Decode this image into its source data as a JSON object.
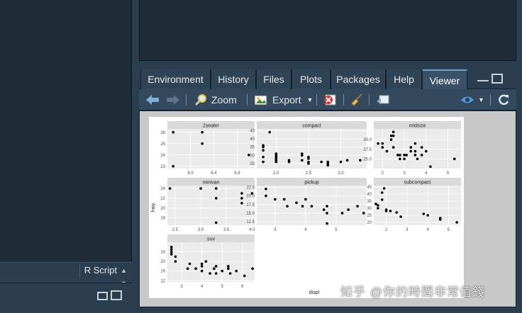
{
  "left_pane": {
    "script_type": "R Script"
  },
  "tabs": [
    {
      "label": "Environment",
      "active": false
    },
    {
      "label": "History",
      "active": false
    },
    {
      "label": "Files",
      "active": false
    },
    {
      "label": "Plots",
      "active": false
    },
    {
      "label": "Packages",
      "active": false
    },
    {
      "label": "Help",
      "active": false
    },
    {
      "label": "Viewer",
      "active": true
    }
  ],
  "toolbar": {
    "zoom_label": "Zoom",
    "export_label": "Export"
  },
  "icons": {
    "back": "arrow-left-icon",
    "forward": "arrow-right-icon",
    "zoom": "magnifier-icon",
    "export": "image-export-icon",
    "remove": "remove-icon",
    "clear": "broom-icon",
    "popout": "popout-icon",
    "publish": "publish-icon",
    "refresh": "refresh-icon"
  },
  "watermark": "知乎 @你的時間非常值錢",
  "chart_data": {
    "type": "scatter",
    "xlabel": "displ",
    "ylabel": "hwy",
    "facets": [
      {
        "name": "2seater",
        "xlim": [
          5.6,
          7.1
        ],
        "ylim": [
          22.8,
          26.3
        ],
        "xticks": [
          6.0,
          6.4,
          6.8
        ],
        "yticks": [
          23,
          24,
          25,
          26
        ],
        "x": [
          5.7,
          5.7,
          6.2,
          6.2,
          7.0
        ],
        "y": [
          26,
          23,
          26,
          25,
          24
        ]
      },
      {
        "name": "compact",
        "xlim": [
          1.7,
          3.4
        ],
        "ylim": [
          22,
          46
        ],
        "xticks": [
          2.0,
          2.5,
          3.0
        ],
        "yticks": [
          25,
          30,
          35,
          40,
          45
        ],
        "x": [
          1.8,
          1.8,
          1.8,
          1.8,
          1.8,
          1.9,
          2.0,
          2.0,
          2.0,
          2.0,
          2.0,
          2.0,
          2.2,
          2.2,
          2.4,
          2.4,
          2.4,
          2.5,
          2.5,
          2.5,
          2.5,
          2.7,
          2.8,
          2.8,
          2.8,
          3.0,
          3.1,
          3.3
        ],
        "y": [
          29,
          33,
          35,
          36,
          26,
          44,
          28,
          29,
          31,
          30,
          27,
          26,
          27,
          26,
          30,
          31,
          27,
          29,
          28,
          26,
          25,
          26,
          24,
          25,
          26,
          26,
          27,
          27
        ]
      },
      {
        "name": "midsize",
        "xlim": [
          1.6,
          5.6
        ],
        "ylim": [
          22.5,
          32.8
        ],
        "xticks": [
          2,
          3,
          4,
          5
        ],
        "yticks": [
          25.0,
          27.5,
          30.0
        ],
        "x": [
          1.8,
          2.0,
          2.0,
          2.2,
          2.4,
          2.4,
          2.5,
          2.5,
          2.5,
          2.7,
          2.8,
          2.8,
          3.0,
          3.0,
          3.1,
          3.3,
          3.3,
          3.5,
          3.5,
          3.5,
          3.6,
          3.8,
          3.8,
          4.0,
          4.2,
          5.3
        ],
        "y": [
          29,
          28,
          29,
          27,
          31,
          30,
          32,
          31,
          28,
          26,
          26,
          25,
          26,
          25,
          26,
          28,
          27,
          26,
          29,
          27,
          25,
          26,
          28,
          27,
          23,
          25
        ]
      },
      {
        "name": "minivan",
        "xlim": [
          2.35,
          4.05
        ],
        "ylim": [
          16.5,
          24.6
        ],
        "xticks": [
          2.5,
          3.0,
          3.5,
          4.0
        ],
        "yticks": [
          18,
          20,
          22,
          24
        ],
        "x": [
          2.4,
          3.0,
          3.3,
          3.3,
          3.3,
          3.8,
          3.8,
          3.8,
          4.0
        ],
        "y": [
          24,
          24,
          24,
          22,
          17,
          23,
          22,
          21,
          23
        ]
      },
      {
        "name": "pickup",
        "xlim": [
          2.4,
          6.0
        ],
        "ylim": [
          11.5,
          23.0
        ],
        "xticks": [
          3,
          4,
          5
        ],
        "yticks": [
          12.5,
          15.0,
          17.5,
          20.0,
          22.5
        ],
        "x": [
          2.7,
          2.7,
          3.0,
          3.3,
          3.4,
          3.7,
          3.9,
          4.0,
          4.2,
          4.6,
          4.7,
          4.7,
          4.7,
          5.2,
          5.4,
          5.7,
          5.9
        ],
        "y": [
          20,
          22,
          19,
          19,
          17,
          18,
          17,
          19,
          17,
          16,
          17,
          15,
          12,
          15,
          16,
          17,
          15
        ]
      },
      {
        "name": "subcompact",
        "xlim": [
          1.4,
          5.6
        ],
        "ylim": [
          18,
          46
        ],
        "xticks": [
          2,
          3,
          4,
          5
        ],
        "yticks": [
          20,
          25,
          30,
          35,
          40,
          45
        ],
        "x": [
          1.5,
          1.6,
          1.6,
          1.8,
          1.8,
          1.9,
          2.0,
          2.0,
          2.2,
          2.5,
          2.7,
          3.8,
          4.0,
          4.6,
          4.6,
          5.4
        ],
        "y": [
          33,
          32,
          30,
          36,
          41,
          44,
          28,
          29,
          28,
          27,
          24,
          26,
          25,
          23,
          22,
          20
        ]
      },
      {
        "name": "suv",
        "xlim": [
          2.3,
          6.6
        ],
        "ylim": [
          11.5,
          28.0
        ],
        "xticks": [
          3,
          4,
          5,
          6
        ],
        "yticks": [
          12,
          16,
          20,
          24
        ],
        "x": [
          2.5,
          2.5,
          2.5,
          2.5,
          2.7,
          2.7,
          3.3,
          3.4,
          3.7,
          4.0,
          4.0,
          4.0,
          4.2,
          4.4,
          4.6,
          4.7,
          4.7,
          5.0,
          5.3,
          5.3,
          5.4,
          5.7,
          6.1,
          6.5
        ],
        "y": [
          25,
          26,
          23,
          24,
          20,
          22,
          17,
          19,
          17,
          18,
          19,
          16,
          20,
          15,
          17,
          18,
          15,
          16,
          17,
          18,
          15,
          16,
          14,
          17
        ]
      }
    ]
  }
}
